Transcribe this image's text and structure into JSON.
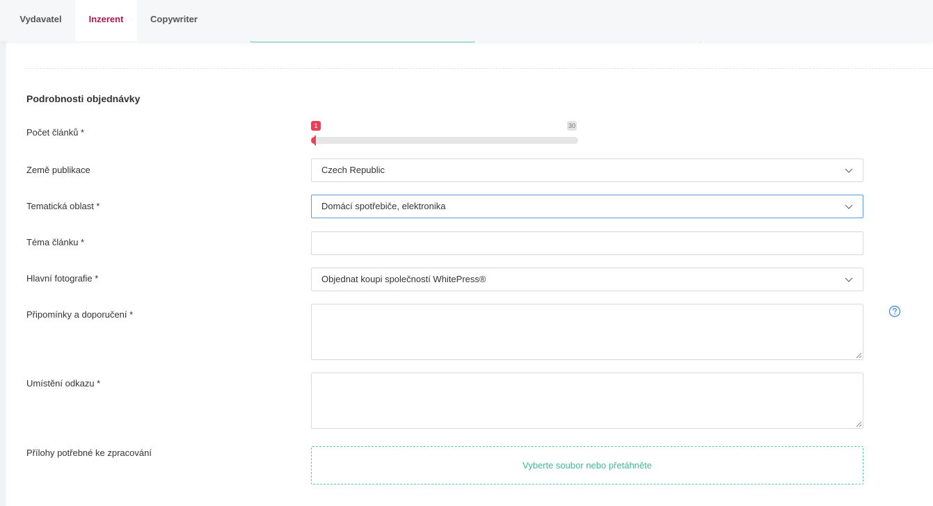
{
  "tabs": [
    {
      "label": "Vydavatel"
    },
    {
      "label": "Inzerent",
      "active": true
    },
    {
      "label": "Copywriter"
    }
  ],
  "colors": {
    "active_tab": "#b0174f",
    "slider": "#e8405a",
    "focus_border": "#5b9bd5",
    "dropzone": "#59c7a6",
    "help_icon": "#4a90d9"
  },
  "section": {
    "title": "Podrobnosti objednávky"
  },
  "form": {
    "article_count": {
      "label": "Počet článků *",
      "value": 1,
      "min": 1,
      "max": 30,
      "value_label": "1",
      "max_label": "30"
    },
    "country": {
      "label": "Země publikace",
      "value": "Czech Republic",
      "icon": "chevron-down-icon"
    },
    "topic_area": {
      "label": "Tematická oblast *",
      "value": "Domácí spotřebiče, elektronika",
      "icon": "chevron-down-icon"
    },
    "article_topic": {
      "label": "Téma článku *",
      "value": ""
    },
    "main_photo": {
      "label": "Hlavní fotografie *",
      "value": "Objednat koupi společností WhitePress®",
      "icon": "chevron-down-icon"
    },
    "comments": {
      "label": "Připomínky a doporučení *",
      "value": "",
      "help_icon": "question-circle-icon"
    },
    "link_placement": {
      "label": "Umístění odkazu *",
      "value": ""
    },
    "attachments": {
      "label": "Přílohy potřebné ke zpracování",
      "dropzone_text": "Vyberte soubor nebo přetáhněte"
    }
  }
}
